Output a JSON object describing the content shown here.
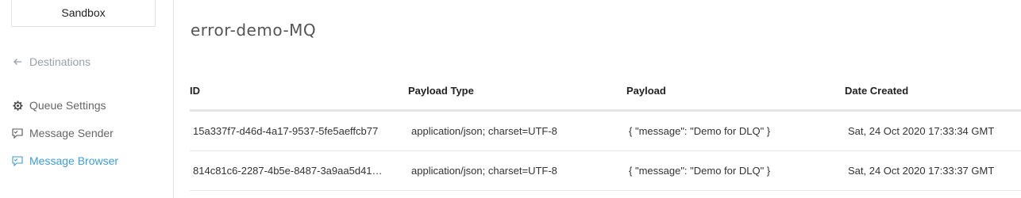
{
  "sidebar": {
    "environment": "Sandbox",
    "back_link": "Destinations",
    "items": [
      {
        "label": "Queue Settings",
        "icon": "gear-icon"
      },
      {
        "label": "Message Sender",
        "icon": "message-icon"
      },
      {
        "label": "Message Browser",
        "icon": "message-icon",
        "active": true
      }
    ]
  },
  "main": {
    "title": "error-demo-MQ",
    "table": {
      "headers": [
        "ID",
        "Payload Type",
        "Payload",
        "Date Created"
      ],
      "rows": [
        [
          "15a337f7-d46d-4a17-9537-5fe5aeffcb77",
          "application/json; charset=UTF-8",
          "{ \"message\": \"Demo for DLQ\" }",
          "Sat, 24 Oct 2020 17:33:34 GMT"
        ],
        [
          "814c81c6-2287-4b5e-8487-3a9aa5d41…",
          "application/json; charset=UTF-8",
          "{ \"message\": \"Demo for DLQ\" }",
          "Sat, 24 Oct 2020 17:33:37 GMT"
        ]
      ]
    }
  },
  "colors": {
    "active": "#3c9fd6",
    "muted": "#9aa0a6",
    "text": "#333333",
    "border": "#e4e4e4"
  }
}
